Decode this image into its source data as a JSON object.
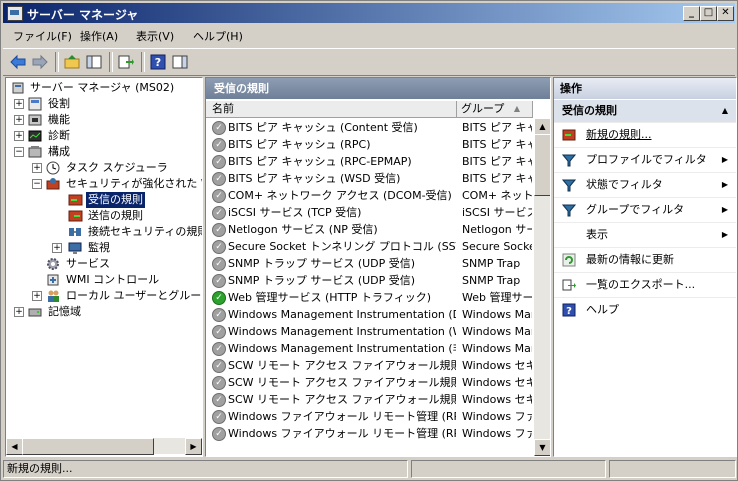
{
  "window": {
    "title": "サーバー マネージャ"
  },
  "menu": [
    "ファイル(F)",
    "操作(A)",
    "表示(V)",
    "ヘルプ(H)"
  ],
  "tree": [
    {
      "label": "サーバー マネージャ (MS02)",
      "level": 0,
      "expander": "",
      "icon": "server-manager-icon"
    },
    {
      "label": "役割",
      "level": 1,
      "expander": "+",
      "icon": "roles-icon"
    },
    {
      "label": "機能",
      "level": 1,
      "expander": "+",
      "icon": "features-icon"
    },
    {
      "label": "診断",
      "level": 1,
      "expander": "+",
      "icon": "diagnostics-icon"
    },
    {
      "label": "構成",
      "level": 1,
      "expander": "−",
      "icon": "configuration-icon"
    },
    {
      "label": "タスク スケジューラ",
      "level": 2,
      "expander": "+",
      "icon": "clock-icon"
    },
    {
      "label": "セキュリティが強化された Windows ファイアウォール",
      "level": 2,
      "expander": "−",
      "icon": "firewall-icon"
    },
    {
      "label": "受信の規則",
      "level": 3,
      "expander": "",
      "icon": "inbound-rules-icon",
      "selected": true
    },
    {
      "label": "送信の規則",
      "level": 3,
      "expander": "",
      "icon": "outbound-rules-icon"
    },
    {
      "label": "接続セキュリティの規則",
      "level": 3,
      "expander": "",
      "icon": "connection-security-icon"
    },
    {
      "label": "監視",
      "level": 3,
      "expander": "+",
      "icon": "monitor-icon"
    },
    {
      "label": "サービス",
      "level": 2,
      "expander": "",
      "icon": "gear-icon"
    },
    {
      "label": "WMI コントロール",
      "level": 2,
      "expander": "",
      "icon": "wmi-icon"
    },
    {
      "label": "ローカル ユーザーとグループ",
      "level": 2,
      "expander": "+",
      "icon": "users-icon"
    },
    {
      "label": "記憶域",
      "level": 1,
      "expander": "+",
      "icon": "storage-icon"
    }
  ],
  "center": {
    "title": "受信の規則",
    "columns": [
      "名前",
      "グループ"
    ],
    "rows": [
      {
        "name": "BITS ピア キャッシュ (Content 受信)",
        "group": "BITS ピア キャッシュ",
        "enabled": false
      },
      {
        "name": "BITS ピア キャッシュ (RPC)",
        "group": "BITS ピア キャッシュ",
        "enabled": false
      },
      {
        "name": "BITS ピア キャッシュ (RPC-EPMAP)",
        "group": "BITS ピア キャッシュ",
        "enabled": false
      },
      {
        "name": "BITS ピア キャッシュ (WSD 受信)",
        "group": "BITS ピア キャッシュ",
        "enabled": false
      },
      {
        "name": "COM+ ネットワーク アクセス (DCOM-受信)",
        "group": "COM+ ネットワーク アクセス",
        "enabled": false
      },
      {
        "name": "iSCSI サービス (TCP 受信)",
        "group": "iSCSI サービス",
        "enabled": false
      },
      {
        "name": "Netlogon サービス (NP 受信)",
        "group": "Netlogon サービス",
        "enabled": false
      },
      {
        "name": "Secure Socket トンネリング プロトコル (SSTP 受信)",
        "group": "Secure Socket",
        "enabled": false
      },
      {
        "name": "SNMP トラップ サービス (UDP 受信)",
        "group": "SNMP Trap",
        "enabled": false
      },
      {
        "name": "SNMP トラップ サービス (UDP 受信)",
        "group": "SNMP Trap",
        "enabled": false
      },
      {
        "name": "Web 管理サービス (HTTP トラフィック)",
        "group": "Web 管理サービス",
        "enabled": true
      },
      {
        "name": "Windows Management Instrumentation (DCOM-In)",
        "group": "Windows Management",
        "enabled": false
      },
      {
        "name": "Windows Management Instrumentation (WMI-In)",
        "group": "Windows Management",
        "enabled": false
      },
      {
        "name": "Windows Management Instrumentation (非同期受信)",
        "group": "Windows Management",
        "enabled": false
      },
      {
        "name": "SCW リモート アクセス ファイアウォール規則 - ...",
        "group": "Windows セキュリティ",
        "enabled": false
      },
      {
        "name": "SCW リモート アクセス ファイアウォール規則 - ...",
        "group": "Windows セキュリティ",
        "enabled": false
      },
      {
        "name": "SCW リモート アクセス ファイアウォール規則 - ...",
        "group": "Windows セキュリティ",
        "enabled": false
      },
      {
        "name": "Windows ファイアウォール リモート管理 (RPC)",
        "group": "Windows ファイアウォール",
        "enabled": false
      },
      {
        "name": "Windows ファイアウォール リモート管理 (RPC-EPMAP)",
        "group": "Windows ファイアウォール",
        "enabled": false
      }
    ]
  },
  "actions": {
    "header": "操作",
    "section": "受信の規則",
    "items": [
      {
        "label": "新規の規則...",
        "icon": "new-rule-icon",
        "arrow": false
      },
      {
        "label": "プロファイルでフィルタ",
        "icon": "filter-icon",
        "arrow": true
      },
      {
        "label": "状態でフィルタ",
        "icon": "filter-icon",
        "arrow": true
      },
      {
        "label": "グループでフィルタ",
        "icon": "filter-icon",
        "arrow": true
      },
      {
        "label": "表示",
        "icon": "",
        "arrow": true
      },
      {
        "label": "最新の情報に更新",
        "icon": "refresh-icon",
        "arrow": false
      },
      {
        "label": "一覧のエクスポート...",
        "icon": "export-icon",
        "arrow": false
      },
      {
        "label": "ヘルプ",
        "icon": "help-icon",
        "arrow": false
      }
    ]
  },
  "status": {
    "text": "新規の規則..."
  },
  "colors": {
    "titlebar": "#0a246a",
    "selection": "#0a246a",
    "enabled_rule": "#2ea22e"
  }
}
